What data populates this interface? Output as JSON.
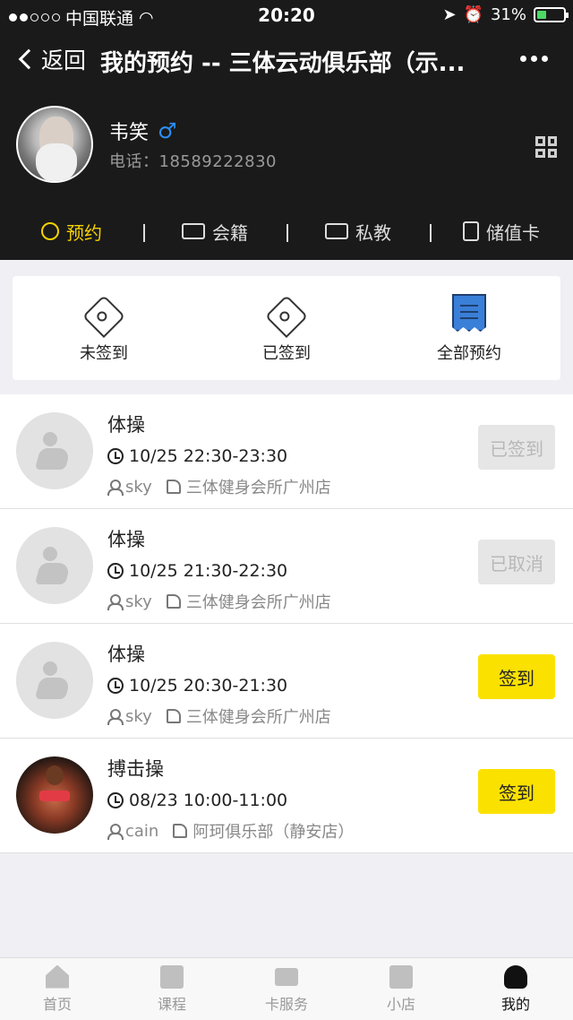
{
  "status_bar": {
    "carrier": "中国联通",
    "time": "20:20",
    "battery": "31%"
  },
  "nav": {
    "back_label": "返回",
    "title": "我的预约 -- 三体云动俱乐部（示..."
  },
  "profile": {
    "name": "韦笑",
    "gender_symbol": "♂",
    "phone": "电话：18589222830"
  },
  "tabs": [
    {
      "label": "预约",
      "icon": "alarm-clock-icon",
      "active": true
    },
    {
      "label": "会籍",
      "icon": "membership-card-icon",
      "active": false
    },
    {
      "label": "私教",
      "icon": "id-card-icon",
      "active": false
    },
    {
      "label": "储值卡",
      "icon": "stored-value-card-icon",
      "active": false
    }
  ],
  "filters": [
    {
      "label": "未签到",
      "icon": "tag-unchecked-icon"
    },
    {
      "label": "已签到",
      "icon": "tag-checked-icon"
    },
    {
      "label": "全部预约",
      "icon": "receipt-icon"
    }
  ],
  "bookings": [
    {
      "title": "体操",
      "date": "10/25",
      "time": "22:30-23:30",
      "coach": "sky",
      "location": "三体健身会所广州店",
      "action": "已签到",
      "state": "disabled"
    },
    {
      "title": "体操",
      "date": "10/25",
      "time": "21:30-22:30",
      "coach": "sky",
      "location": "三体健身会所广州店",
      "action": "已取消",
      "state": "disabled"
    },
    {
      "title": "体操",
      "date": "10/25",
      "time": "20:30-21:30",
      "coach": "sky",
      "location": "三体健身会所广州店",
      "action": "签到",
      "state": "active"
    },
    {
      "title": "搏击操",
      "date": "08/23",
      "time": "10:00-11:00",
      "coach": "cain",
      "location": "阿珂俱乐部（静安店）",
      "action": "签到",
      "state": "active"
    }
  ],
  "bottom_tabs": [
    {
      "label": "首页",
      "icon": "home-icon",
      "active": false
    },
    {
      "label": "课程",
      "icon": "clipboard-icon",
      "active": false
    },
    {
      "label": "卡服务",
      "icon": "card-icon",
      "active": false
    },
    {
      "label": "小店",
      "icon": "shop-icon",
      "active": false
    },
    {
      "label": "我的",
      "icon": "person-icon",
      "active": true
    }
  ],
  "colors": {
    "accent": "#fbe100",
    "header_bg": "#1a1a1a",
    "male_blue": "#2b8ef3"
  }
}
